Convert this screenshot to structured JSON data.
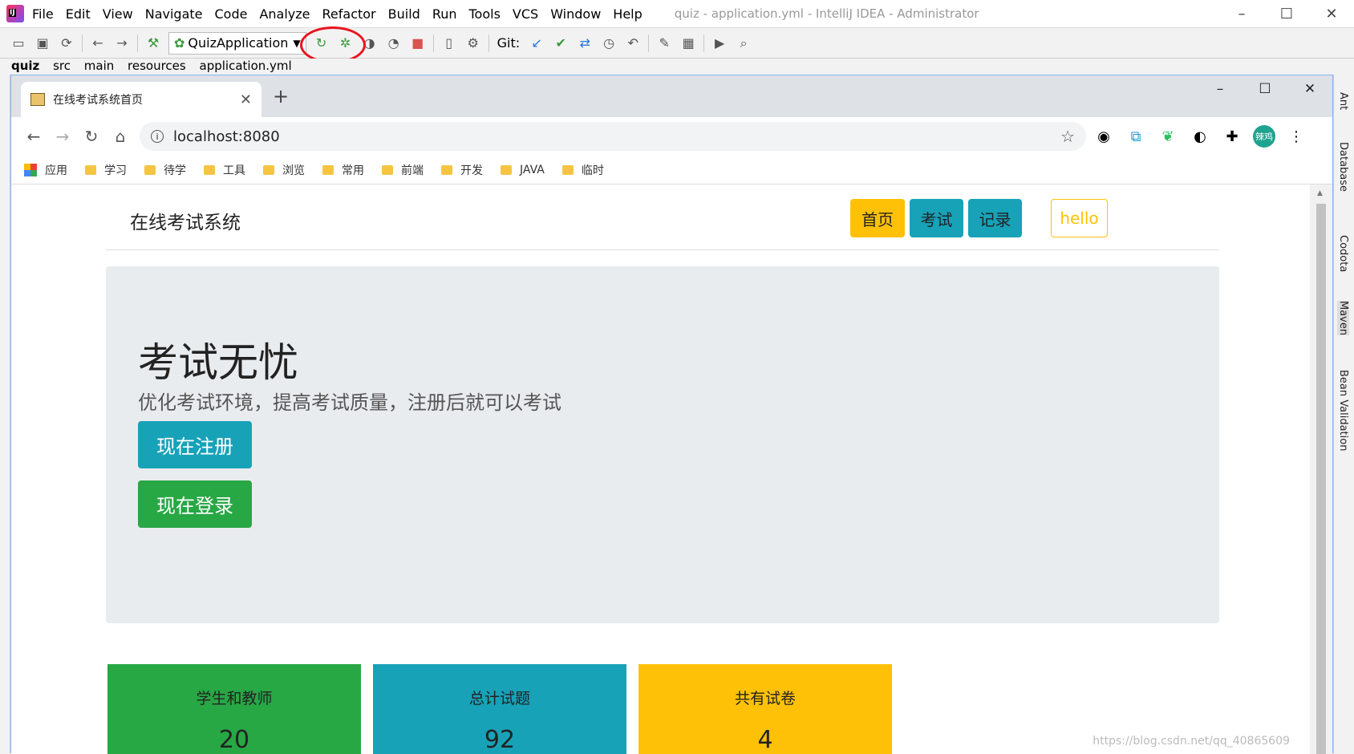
{
  "ide": {
    "menu": [
      "File",
      "Edit",
      "View",
      "Navigate",
      "Code",
      "Analyze",
      "Refactor",
      "Build",
      "Run",
      "Tools",
      "VCS",
      "Window",
      "Help"
    ],
    "window_title": "quiz - application.yml - IntelliJ IDEA - Administrator",
    "run_config": "QuizApplication",
    "git_label": "Git:",
    "breadcrumb": [
      "quiz",
      "src",
      "main",
      "resources",
      "application.yml"
    ],
    "right_tools": [
      "Ant",
      "Database",
      "Codota",
      "Maven",
      "Bean Validation"
    ]
  },
  "browser": {
    "tab_title": "在线考试系统首页",
    "url": "localhost:8080",
    "avatar_text": "辣鸡",
    "bookmarks": [
      "应用",
      "学习",
      "待学",
      "工具",
      "浏览",
      "常用",
      "前端",
      "开发",
      "JAVA",
      "临时"
    ]
  },
  "site": {
    "brand": "在线考试系统",
    "nav": [
      "首页",
      "考试",
      "记录"
    ],
    "user": "hello",
    "hero_title": "考试无忧",
    "hero_subtitle": "优化考试环境，提高考试质量，注册后就可以考试",
    "register_btn": "现在注册",
    "login_btn": "现在登录",
    "cards": [
      {
        "label": "学生和教师",
        "value": "20",
        "color": "#28a745"
      },
      {
        "label": "总计试题",
        "value": "92",
        "color": "#17a2b8"
      },
      {
        "label": "共有试卷",
        "value": "4",
        "color": "#ffc107"
      }
    ]
  },
  "watermark": "https://blog.csdn.net/qq_40865609"
}
